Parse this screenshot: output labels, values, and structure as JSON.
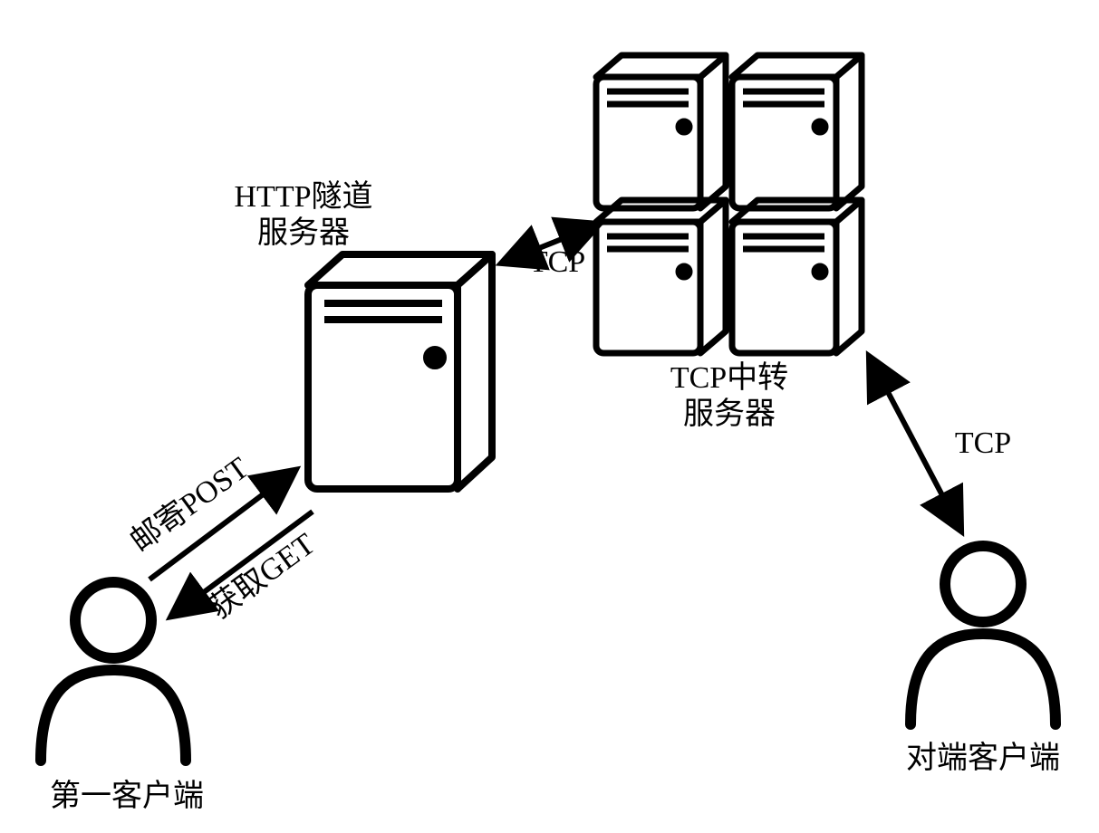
{
  "nodes": {
    "http_tunnel_server": {
      "label_line1": "HTTP隧道",
      "label_line2": "服务器"
    },
    "tcp_relay_server": {
      "label_line1": "TCP中转",
      "label_line2": "服务器"
    },
    "first_client": {
      "label": "第一客户端"
    },
    "peer_client": {
      "label": "对端客户端"
    }
  },
  "edges": {
    "client_to_http_post": {
      "label": "邮寄POST"
    },
    "http_to_client_get": {
      "label": "获取GET"
    },
    "http_to_tcp": {
      "label": "TCP"
    },
    "tcp_to_peer": {
      "label": "TCP"
    }
  }
}
